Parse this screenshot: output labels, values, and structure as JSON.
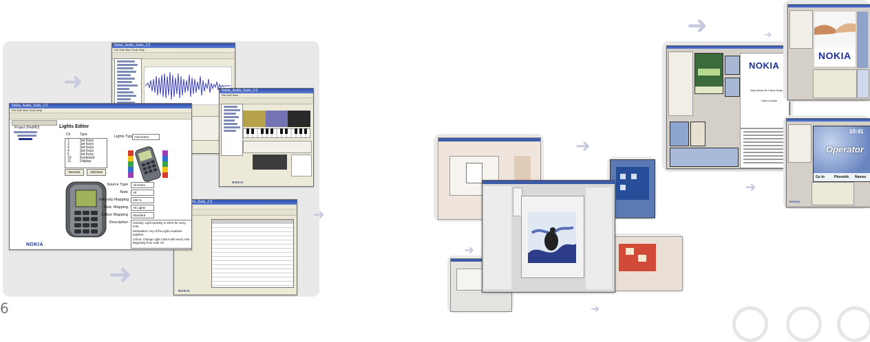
{
  "page_number": "6",
  "left_cluster": {
    "main_window_title": "Nokia_Audio_Suite_2.0",
    "light_editor": {
      "heading": "Lights Editor",
      "list_headers": [
        "Ch",
        "Type"
      ],
      "list_rows": [
        [
          "1",
          "Set Keys"
        ],
        [
          "2",
          "Set Keys"
        ],
        [
          "3",
          "Set Keys"
        ],
        [
          "4",
          "Set Keys"
        ],
        [
          "5",
          "Set Keys"
        ],
        [
          "10",
          "Keyboard"
        ],
        [
          "11",
          "Display"
        ]
      ],
      "lights_type_label": "Lights Type",
      "lights_type_value": "Add Notes",
      "buttons": [
        "Remove",
        "Add New"
      ],
      "form": [
        {
          "label": "Source Type",
          "value": "All Notes"
        },
        {
          "label": "Note",
          "value": "All"
        },
        {
          "label": "Intensity Mapping",
          "value": "100 %"
        },
        {
          "label": "Dest. Mapping",
          "value": "All Lights"
        },
        {
          "label": "Colour Mapping",
          "value": "Standard"
        }
      ],
      "description_label": "Description",
      "description_lines": [
        "Intensity: Light intensity is 100% for every note.",
        "Destination: Any of the Light Locations together.",
        "Colour: Change Light Colour with every note. Beginning from code C0."
      ],
      "logo": "NOKIA"
    },
    "sub_logo": "NOKIA",
    "project_tree_root": "Project (PedHD)"
  },
  "right_cluster": {
    "doc_logo": "NOKIA",
    "doc_title": "Nokia Series 60 Theme Studio",
    "doc_subtitle": "User's Guide",
    "photo_logo": "NOKIA",
    "operator_label": "Operator",
    "clock": "10:41",
    "softkeys": [
      "Go to",
      "Phonebk",
      "Names"
    ],
    "corner_logo": "NOKIA"
  },
  "colors": {
    "arrow": "#c6cbe0",
    "titlebar": "#2f4fa8",
    "panel": "#e9e9e9"
  }
}
